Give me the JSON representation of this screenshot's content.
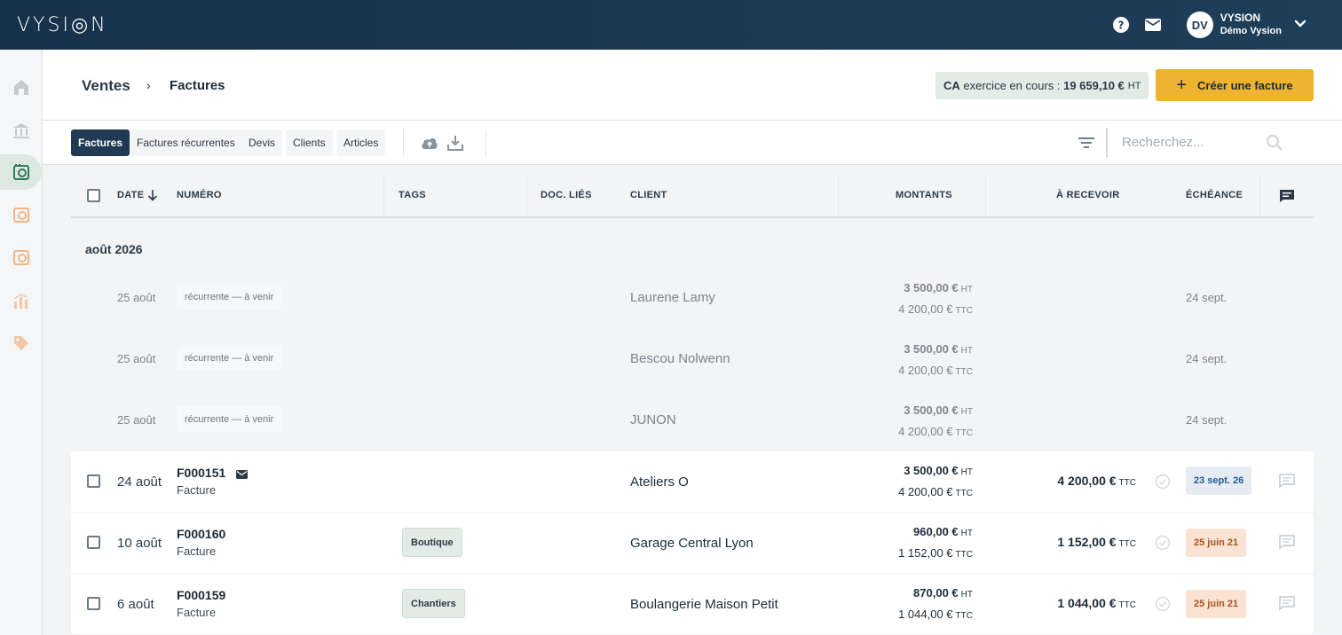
{
  "brand": {
    "logo": "VYSI◎N"
  },
  "user": {
    "initials": "DV",
    "name": "VYSION",
    "org": "Démo Vysion"
  },
  "breadcrumb": {
    "section": "Ventes",
    "separator": "›",
    "page": "Factures"
  },
  "revenue": {
    "label": "CA",
    "text": " exercice en cours : ",
    "value": "19 659,10 €",
    "unit": "HT"
  },
  "create_button": {
    "label": "Créer une facture"
  },
  "tabs": [
    {
      "label": "Factures",
      "active": true
    },
    {
      "label": "Factures récurrentes",
      "active": false
    },
    {
      "label": "Devis",
      "active": false
    },
    {
      "label": "Clients",
      "active": false
    },
    {
      "label": "Articles",
      "active": false
    }
  ],
  "search": {
    "placeholder": "Recherchez..."
  },
  "columns": {
    "date": "DATE",
    "number": "NUMÉRO",
    "tags": "TAGS",
    "docs": "DOC. LIÉS",
    "client": "CLIENT",
    "amounts": "MONTANTS",
    "receivable": "À RECEVOIR",
    "due": "ÉCHÉANCE"
  },
  "group": {
    "title": "août 2026"
  },
  "upcoming": [
    {
      "date": "25 août",
      "status": "récurrente — à venir",
      "client": "Laurene Lamy",
      "ht": "3 500,00 €",
      "ttc": "4 200,00 €",
      "due": "24 sept."
    },
    {
      "date": "25 août",
      "status": "récurrente — à venir",
      "client": "Bescou Nolwenn",
      "ht": "3 500,00 €",
      "ttc": "4 200,00 €",
      "due": "24 sept."
    },
    {
      "date": "25 août",
      "status": "récurrente — à venir",
      "client": "JUNON",
      "ht": "3 500,00 €",
      "ttc": "4 200,00 €",
      "due": "24 sept."
    }
  ],
  "units": {
    "ht": "HT",
    "ttc": "TTC"
  },
  "invoices": [
    {
      "date": "24 août",
      "number": "F000151",
      "type": "Facture",
      "tag": "",
      "client": "Ateliers O",
      "ht": "3 500,00 €",
      "ttc": "4 200,00 €",
      "receivable": "4 200,00 €",
      "due": "23 sept. 26"
    },
    {
      "date": "10 août",
      "number": "F000160",
      "type": "Facture",
      "tag": "Boutique",
      "client": "Garage Central Lyon",
      "ht": "960,00 €",
      "ttc": "1 152,00 €",
      "receivable": "1 152,00 €",
      "due": "25 juin 21"
    },
    {
      "date": "6 août",
      "number": "F000159",
      "type": "Facture",
      "tag": "Chantiers",
      "client": "Boulangerie Maison Petit",
      "ht": "870,00 €",
      "ttc": "1 044,00 €",
      "receivable": "1 044,00 €",
      "due": "25 juin 21"
    }
  ],
  "colors": {
    "topbar": "#17324a",
    "accent": "#efb32f",
    "active_tab": "#1f3a52",
    "tag_bg": "#e3ebe7",
    "due_blue": "#255a8c",
    "due_orange": "#a4541d"
  },
  "icons": [
    "help-icon",
    "mail-icon",
    "chevron-down-icon",
    "home-icon",
    "bank-icon",
    "sales-icon",
    "purchases-icon",
    "expenses-icon",
    "reports-icon",
    "tags-icon",
    "cloud-upload-icon",
    "download-icon",
    "filter-icon",
    "search-icon",
    "comment-icon",
    "sort-arrow-icon",
    "check-circle-icon"
  ]
}
